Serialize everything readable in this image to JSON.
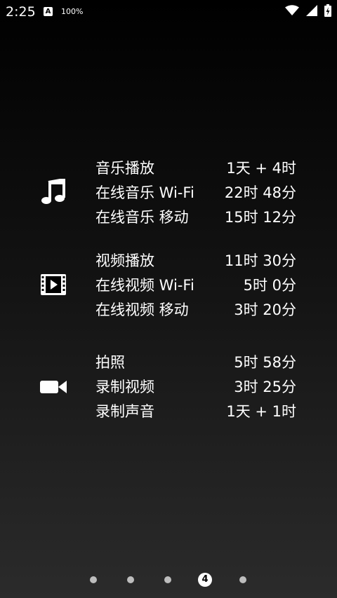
{
  "status_bar": {
    "time": "2:25",
    "notification_badge": "A",
    "battery_text": "100%",
    "icons": [
      "wifi-icon",
      "signal-icon",
      "battery-charging-icon"
    ]
  },
  "sections": [
    {
      "icon": "music-note-icon",
      "rows": [
        {
          "label": "音乐播放",
          "value": "1天 + 4时"
        },
        {
          "label": "在线音乐 Wi-Fi",
          "value": "22时 48分"
        },
        {
          "label": "在线音乐 移动",
          "value": "15时 12分"
        }
      ]
    },
    {
      "icon": "video-film-icon",
      "rows": [
        {
          "label": "视频播放",
          "value": "11时 30分"
        },
        {
          "label": "在线视频 Wi-Fi",
          "value": "5时 0分"
        },
        {
          "label": "在线视频 移动",
          "value": "3时 20分"
        }
      ]
    },
    {
      "icon": "video-camera-icon",
      "rows": [
        {
          "label": "拍照",
          "value": "5时 58分"
        },
        {
          "label": "录制视频",
          "value": "3时 25分"
        },
        {
          "label": "录制声音",
          "value": "1天 + 1时"
        }
      ]
    }
  ],
  "pager": {
    "active_page_label": "4",
    "total_pages": 5,
    "active_index": 3
  }
}
